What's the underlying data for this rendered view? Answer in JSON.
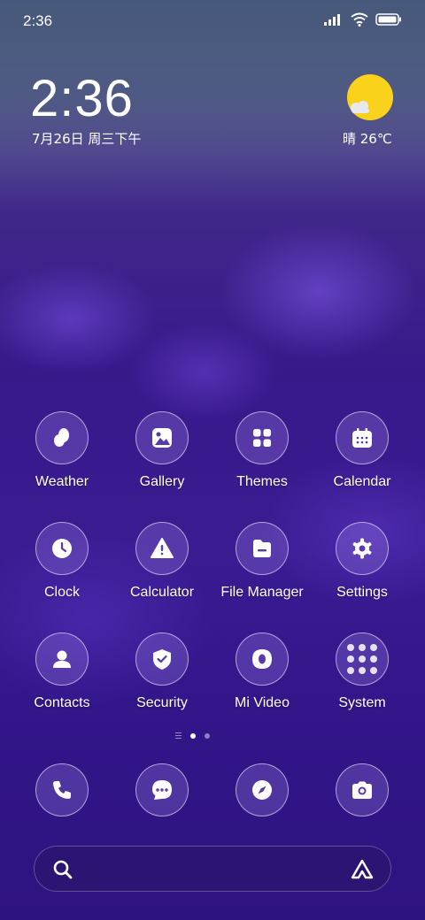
{
  "status_bar": {
    "time": "2:36",
    "icons": [
      "signal-icon",
      "wifi-icon",
      "battery-icon"
    ]
  },
  "clock_widget": {
    "time": "2:36",
    "date": "7月26日 周三下午"
  },
  "weather_widget": {
    "text": "晴 26℃",
    "icon": "sunny-partly-cloudy-icon",
    "sun_color": "#FBD21B"
  },
  "apps": [
    {
      "label": "Weather",
      "icon": "weather-icon"
    },
    {
      "label": "Gallery",
      "icon": "gallery-icon"
    },
    {
      "label": "Themes",
      "icon": "themes-icon"
    },
    {
      "label": "Calendar",
      "icon": "calendar-icon"
    },
    {
      "label": "Clock",
      "icon": "clock-icon"
    },
    {
      "label": "Calculator",
      "icon": "calculator-icon"
    },
    {
      "label": "File Manager",
      "icon": "file-manager-icon"
    },
    {
      "label": "Settings",
      "icon": "settings-icon"
    },
    {
      "label": "Contacts",
      "icon": "contacts-icon"
    },
    {
      "label": "Security",
      "icon": "security-icon"
    },
    {
      "label": "Mi Video",
      "icon": "mi-video-icon"
    },
    {
      "label": "System",
      "icon": "system-folder-icon"
    }
  ],
  "page_indicator": {
    "pages": 2,
    "active_page": 1
  },
  "dock": [
    {
      "icon": "phone-icon"
    },
    {
      "icon": "messages-icon"
    },
    {
      "icon": "browser-compass-icon"
    },
    {
      "icon": "camera-icon"
    }
  ],
  "search_bar": {
    "search_icon": "search-icon",
    "assistant_icon": "assistant-icon"
  }
}
